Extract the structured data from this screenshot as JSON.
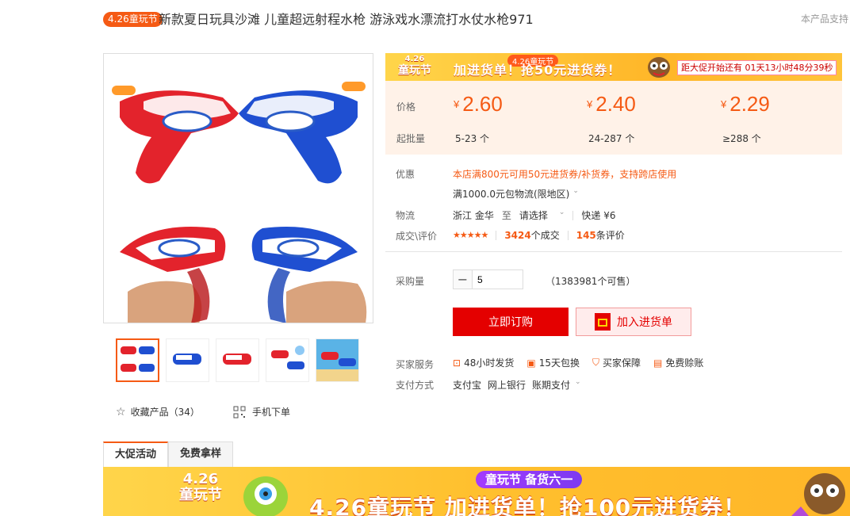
{
  "header": {
    "badge": "4.26童玩节",
    "title": "新款夏日玩具沙滩 儿童超远射程水枪 游泳戏水漂流打水仗水枪971",
    "top_right": "本产品支持"
  },
  "gallery": {
    "thumbnails": [
      "thumb-1",
      "thumb-2",
      "thumb-3",
      "thumb-4",
      "thumb-5"
    ],
    "favorite_label": "收藏产品（34）",
    "mobile_label": "手机下单"
  },
  "promo": {
    "logo_top": "4.26",
    "logo_main": "童玩节",
    "tag": "4.26童玩节",
    "main": "加进货单！抢50元进货券！",
    "countdown": "距大促开始还有 01天13小时48分39秒"
  },
  "price": {
    "price_label": "价格",
    "qty_label": "起批量",
    "yen": "¥",
    "tiers": [
      {
        "price": "2.60",
        "qty": "5-23 个"
      },
      {
        "price": "2.40",
        "qty": "24-287 个"
      },
      {
        "price": "2.29",
        "qty": "≥288 个"
      }
    ]
  },
  "details": {
    "discount_label": "优惠",
    "discount_text": "本店满800元可用50元进货券/补货券，支持跨店使用",
    "free_shipping": "满1000.0元包物流(限地区)",
    "logistics_label": "物流",
    "origin": "浙江 金华",
    "to": "至",
    "select": "请选择",
    "express": "快递 ¥6",
    "deal_label": "成交\\评价",
    "stars": "★★★★★",
    "deals_num": "3424",
    "deals_text": "个成交",
    "reviews_num": "145",
    "reviews_text": "条评价"
  },
  "purchase": {
    "qty_label": "采购量",
    "minus": "−",
    "qty_value": "5",
    "available": "（1383981个可售）",
    "order_button": "立即订购",
    "cart_button": "加入进货单"
  },
  "service": {
    "label": "买家服务",
    "items": [
      "48小时发货",
      "15天包换",
      "买家保障",
      "免费赊账"
    ],
    "pay_label": "支付方式",
    "pay_items": [
      "支付宝",
      "网上银行",
      "账期支付"
    ]
  },
  "tabs": [
    "大促活动",
    "免费拿样"
  ],
  "banner": {
    "logo_top": "4.26",
    "logo_main": "童玩节",
    "sub": "童玩节 备货六一",
    "main": "4.26童玩节 加进货单！抢100元进货券！"
  },
  "colors": {
    "accent": "#f55a14",
    "order": "#e40000",
    "price_bg": "#fff2e8"
  }
}
